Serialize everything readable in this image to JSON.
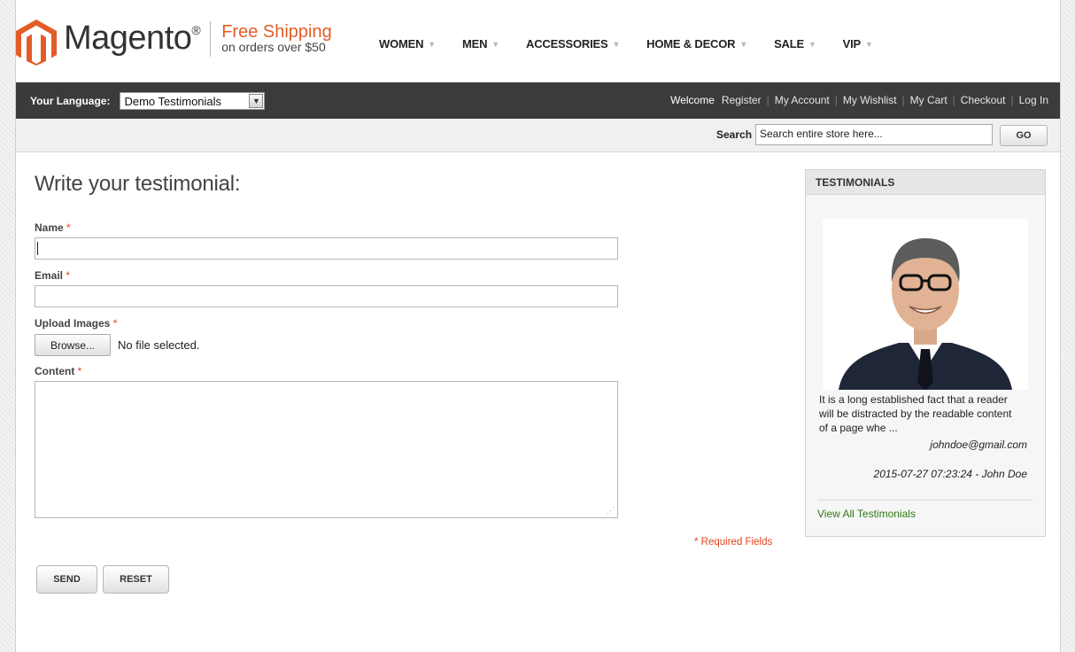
{
  "brand": {
    "name": "Magento",
    "registered": "®",
    "promo_title": "Free Shipping",
    "promo_sub": "on orders over $50",
    "color_orange": "#e35c27"
  },
  "nav": {
    "items": [
      {
        "label": "WOMEN"
      },
      {
        "label": "MEN"
      },
      {
        "label": "ACCESSORIES"
      },
      {
        "label": "HOME & DECOR"
      },
      {
        "label": "SALE"
      },
      {
        "label": "VIP"
      }
    ]
  },
  "topbar": {
    "lang_label": "Your Language:",
    "lang_value": "Demo Testimonials",
    "welcome": "Welcome",
    "links": [
      "Register",
      "My Account",
      "My Wishlist",
      "My Cart",
      "Checkout",
      "Log In"
    ]
  },
  "search": {
    "label": "Search",
    "placeholder": "Search entire store here...",
    "button": "GO"
  },
  "form": {
    "title": "Write your testimonial:",
    "name_label": "Name",
    "email_label": "Email",
    "upload_label": "Upload Images",
    "browse_label": "Browse...",
    "file_status": "No file selected.",
    "content_label": "Content",
    "required_mark": "*",
    "required_note": "* Required Fields",
    "send": "SEND",
    "reset": "RESET"
  },
  "sidebar": {
    "title": "TESTIMONIALS",
    "quote": "It is a long established fact that a reader will be distracted by the readable content of a page whe ...",
    "email": "johndoe@gmail.com",
    "date_author": "2015-07-27 07:23:24 - John Doe",
    "view_all": "View All Testimonials"
  }
}
